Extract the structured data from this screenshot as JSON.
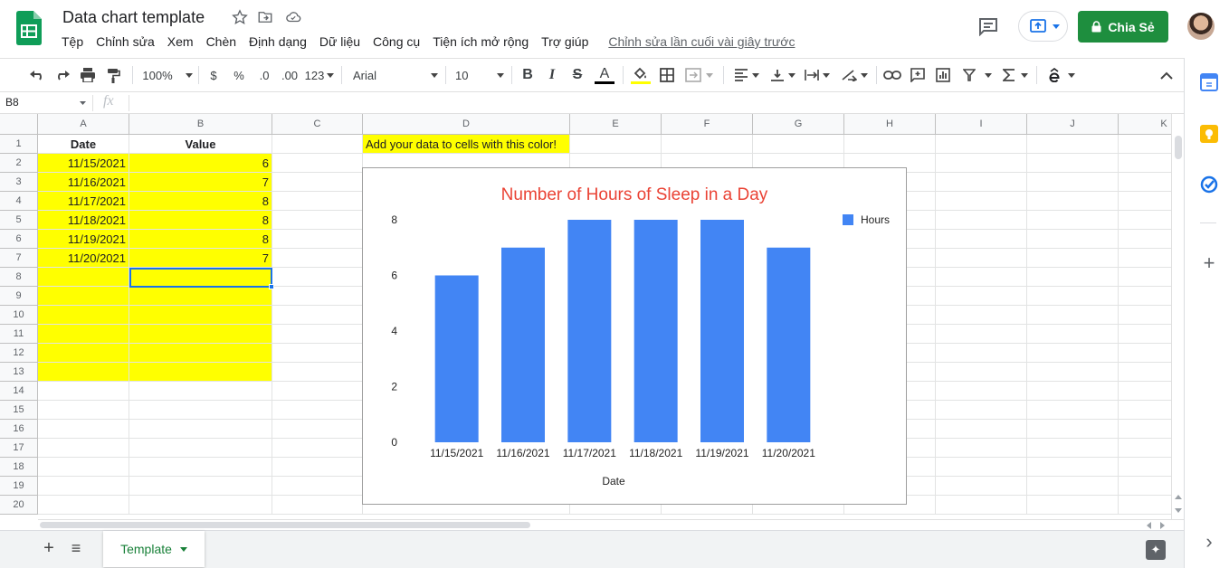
{
  "header": {
    "title": "Data chart template",
    "menu": [
      "Tệp",
      "Chỉnh sửa",
      "Xem",
      "Chèn",
      "Định dạng",
      "Dữ liệu",
      "Công cụ",
      "Tiện ích mở rộng",
      "Trợ giúp"
    ],
    "last_edit": "Chỉnh sửa lần cuối vài giây trước",
    "share_label": "Chia Sẻ"
  },
  "toolbar": {
    "zoom": "100%",
    "currency": "$",
    "percent": "%",
    "dec_decrease": ".0",
    "dec_increase": ".00",
    "more_formats": "123",
    "font": "Arial",
    "font_size": "10",
    "bold": "B",
    "italic": "I",
    "strike": "S",
    "text_color": "A"
  },
  "formula_bar": {
    "cell_ref": "B8",
    "fx": "fx"
  },
  "grid": {
    "columns": [
      "A",
      "B",
      "C",
      "D",
      "E",
      "F",
      "G",
      "H",
      "I",
      "J",
      "K"
    ],
    "rows": [
      "1",
      "2",
      "3",
      "4",
      "5",
      "6",
      "7",
      "8",
      "9",
      "10",
      "11",
      "12",
      "13",
      "14",
      "15",
      "16",
      "17",
      "18",
      "19",
      "20"
    ],
    "header_date": "Date",
    "header_value": "Value",
    "data": [
      {
        "date": "11/15/2021",
        "value": "6"
      },
      {
        "date": "11/16/2021",
        "value": "7"
      },
      {
        "date": "11/17/2021",
        "value": "8"
      },
      {
        "date": "11/18/2021",
        "value": "8"
      },
      {
        "date": "11/19/2021",
        "value": "8"
      },
      {
        "date": "11/20/2021",
        "value": "7"
      }
    ],
    "note": "Add your data to cells with this color!",
    "highlight_color": "#ffff00",
    "selection_color": "#1a73e8"
  },
  "chart_data": {
    "type": "bar",
    "title": "Number of Hours of Sleep in a Day",
    "title_color": "#ea4335",
    "categories": [
      "11/15/2021",
      "11/16/2021",
      "11/17/2021",
      "11/18/2021",
      "11/19/2021",
      "11/20/2021"
    ],
    "series": [
      {
        "name": "Hours",
        "values": [
          6,
          7,
          8,
          8,
          8,
          7
        ],
        "color": "#4285f4"
      }
    ],
    "xlabel": "Date",
    "ylabel": "",
    "ylim": [
      0,
      8
    ],
    "yticks": [
      "0",
      "2",
      "4",
      "6",
      "8"
    ],
    "legend": "top-right",
    "grid": false
  },
  "footer": {
    "sheet_tab": "Template"
  },
  "icons": {
    "add_sheet": "+",
    "sheet_list": "≡",
    "explore": "✦",
    "side_add": "+",
    "side_expand": "›"
  },
  "colors": {
    "brand_green": "#0f9d58",
    "share_green": "#1e8e3e",
    "accent_blue": "#1a73e8"
  }
}
